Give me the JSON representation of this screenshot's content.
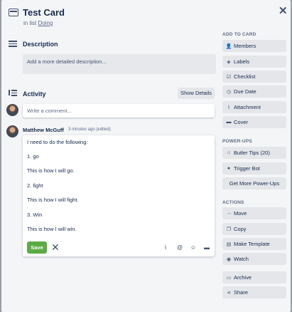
{
  "card": {
    "title": "Test Card",
    "in_list_prefix": "in list",
    "list_name": "Doing"
  },
  "description": {
    "heading": "Description",
    "placeholder": "Add a more detailed description..."
  },
  "activity": {
    "heading": "Activity",
    "show_details_label": "Show Details",
    "comment_placeholder": "Write a comment..."
  },
  "comment": {
    "author": "Matthew McGuff",
    "meta": "3 minutes ago (edited)",
    "lines": [
      "I need to do the following:",
      "1.  go",
      "This is how I will go.",
      "2.  fight",
      "This is how I will fight.",
      "3.  Win",
      "This is how I will win."
    ],
    "save_label": "Save"
  },
  "sidebar": {
    "add_to_card_title": "ADD TO CARD",
    "add_to_card": [
      {
        "label": "Members",
        "icon": "person-icon"
      },
      {
        "label": "Labels",
        "icon": "tag-icon"
      },
      {
        "label": "Checklist",
        "icon": "checkbox-icon"
      },
      {
        "label": "Due Date",
        "icon": "clock-icon"
      },
      {
        "label": "Attachment",
        "icon": "paperclip-icon"
      },
      {
        "label": "Cover",
        "icon": "cover-icon"
      }
    ],
    "power_ups_title": "POWER-UPS",
    "power_ups": [
      {
        "label": "Butler Tips (20)",
        "icon": "butler-icon"
      },
      {
        "label": "Trigger Bot",
        "icon": "bot-icon"
      }
    ],
    "get_more_label": "Get More Power-Ups",
    "actions_title": "ACTIONS",
    "actions": [
      {
        "label": "Move",
        "icon": "arrow-right-icon"
      },
      {
        "label": "Copy",
        "icon": "copy-icon"
      },
      {
        "label": "Make Template",
        "icon": "template-icon"
      },
      {
        "label": "Watch",
        "icon": "eye-icon"
      }
    ],
    "archive_label": "Archive",
    "share_label": "Share"
  },
  "colors": {
    "save_button": "#5aac44",
    "modal_bg": "#f4f5f7",
    "button_bg": "#e4e6ea"
  }
}
